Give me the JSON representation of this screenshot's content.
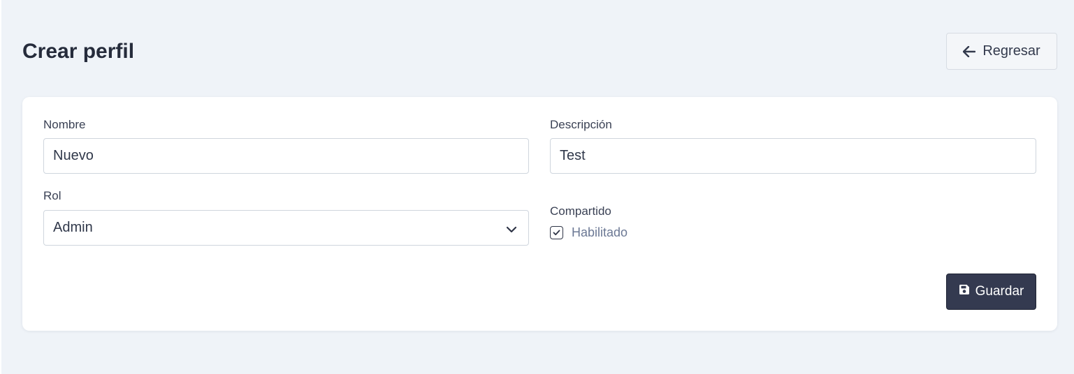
{
  "header": {
    "title": "Crear perfil",
    "back_label": "Regresar"
  },
  "form": {
    "name": {
      "label": "Nombre",
      "value": "Nuevo"
    },
    "description": {
      "label": "Descripción",
      "value": "Test"
    },
    "role": {
      "label": "Rol",
      "selected": "Admin"
    },
    "shared": {
      "label": "Compartido",
      "checkbox_label": "Habilitado",
      "checked": true
    },
    "save_label": "Guardar"
  },
  "icons": {
    "back": "arrow-left-icon",
    "select": "chevron-down-icon",
    "check": "check-icon",
    "save": "floppy-disk-icon"
  },
  "colors": {
    "background": "#eff3f8",
    "card": "#ffffff",
    "primary_button": "#343a50",
    "checkbox_label": "#6b7894"
  }
}
